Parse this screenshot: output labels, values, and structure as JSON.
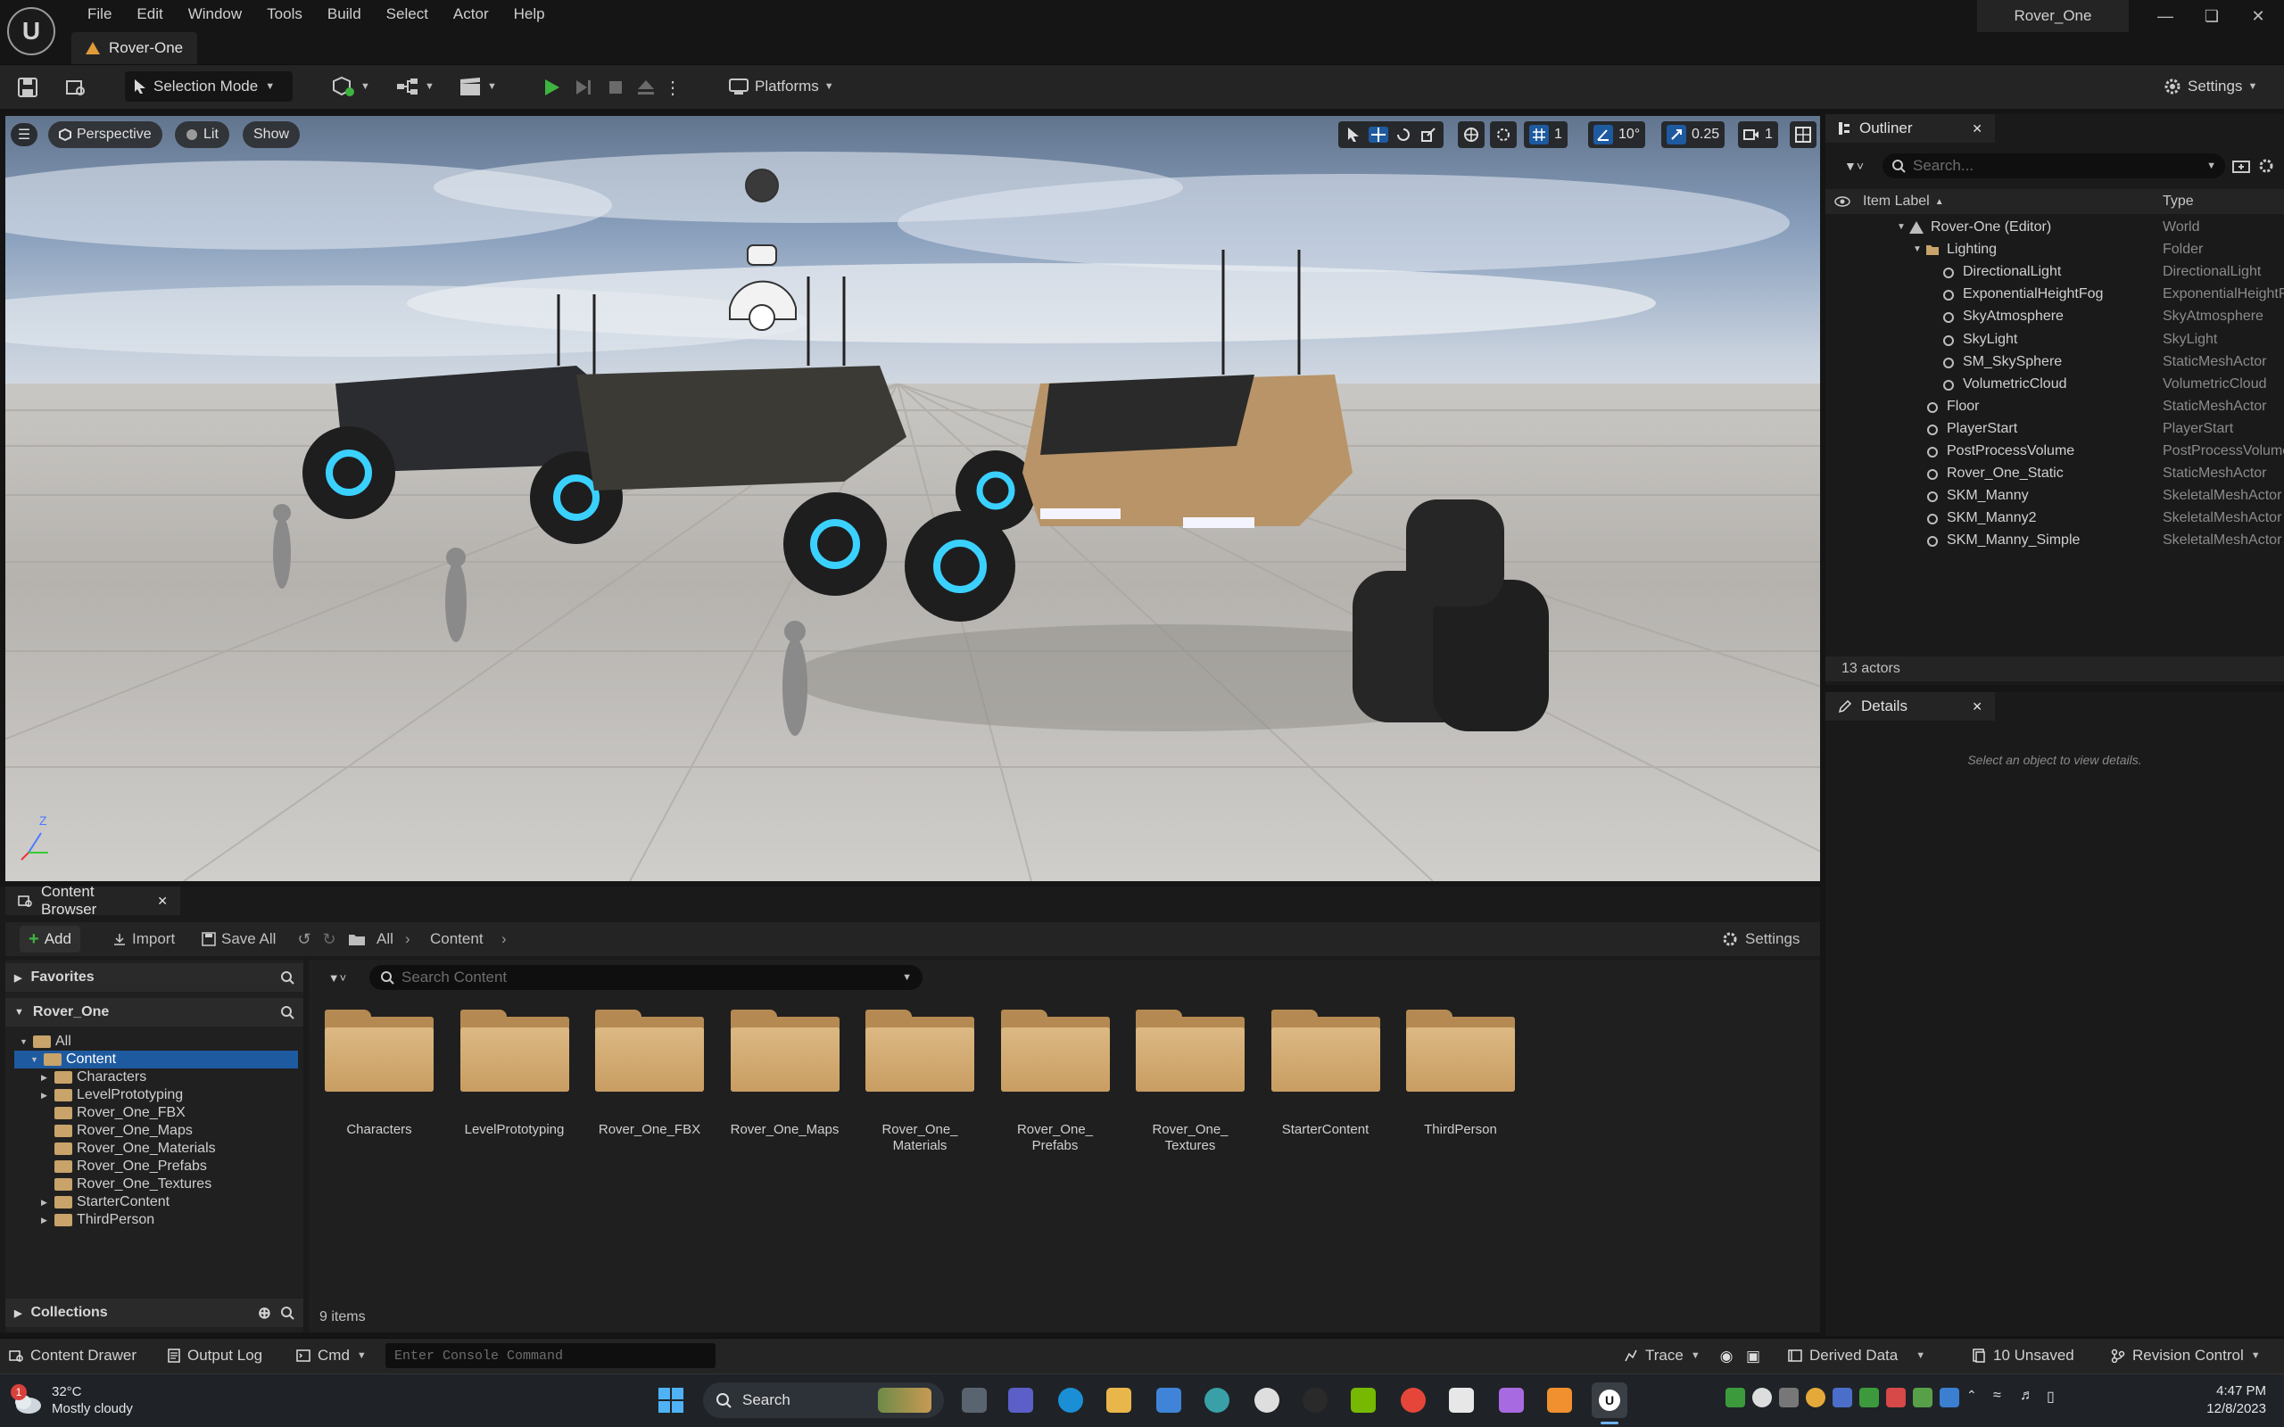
{
  "app": {
    "logo_text": "U",
    "menu": [
      "File",
      "Edit",
      "Window",
      "Tools",
      "Build",
      "Select",
      "Actor",
      "Help"
    ],
    "doc_tab": "Rover-One",
    "project_name": "Rover_One"
  },
  "toolbar": {
    "selection_mode": "Selection Mode",
    "platforms": "Platforms",
    "settings": "Settings"
  },
  "viewport": {
    "perspective": "Perspective",
    "lit": "Lit",
    "show": "Show",
    "grid_snap": "1",
    "rotation_snap": "10°",
    "scale_snap": "0.25",
    "camera_speed": "1",
    "axis_z": "Z"
  },
  "outliner": {
    "tab": "Outliner",
    "search_placeholder": "Search...",
    "col_label": "Item Label",
    "col_type": "Type",
    "rows": [
      {
        "label": "Rover-One (Editor)",
        "type": "World"
      },
      {
        "label": "Lighting",
        "type": "Folder"
      },
      {
        "label": "DirectionalLight",
        "type": "DirectionalLight"
      },
      {
        "label": "ExponentialHeightFog",
        "type": "ExponentialHeightFog"
      },
      {
        "label": "SkyAtmosphere",
        "type": "SkyAtmosphere"
      },
      {
        "label": "SkyLight",
        "type": "SkyLight"
      },
      {
        "label": "SM_SkySphere",
        "type": "StaticMeshActor"
      },
      {
        "label": "VolumetricCloud",
        "type": "VolumetricCloud"
      },
      {
        "label": "Floor",
        "type": "StaticMeshActor"
      },
      {
        "label": "PlayerStart",
        "type": "PlayerStart"
      },
      {
        "label": "PostProcessVolume",
        "type": "PostProcessVolume"
      },
      {
        "label": "Rover_One_Static",
        "type": "StaticMeshActor"
      },
      {
        "label": "SKM_Manny",
        "type": "SkeletalMeshActor"
      },
      {
        "label": "SKM_Manny2",
        "type": "SkeletalMeshActor"
      },
      {
        "label": "SKM_Manny_Simple",
        "type": "SkeletalMeshActor"
      }
    ],
    "actor_count": "13 actors"
  },
  "details": {
    "tab": "Details",
    "empty_message": "Select an object to view details."
  },
  "content_browser": {
    "tab": "Content Browser",
    "add": "Add",
    "import": "Import",
    "save_all": "Save All",
    "path": [
      "All",
      "Content"
    ],
    "settings": "Settings",
    "favorites": "Favorites",
    "project": "Rover_One",
    "collections": "Collections",
    "search_placeholder": "Search Content",
    "tree": [
      {
        "label": "All",
        "level": 0
      },
      {
        "label": "Content",
        "level": 1,
        "selected": true
      },
      {
        "label": "Characters",
        "level": 2
      },
      {
        "label": "LevelPrototyping",
        "level": 2
      },
      {
        "label": "Rover_One_FBX",
        "level": 2
      },
      {
        "label": "Rover_One_Maps",
        "level": 2
      },
      {
        "label": "Rover_One_Materials",
        "level": 2
      },
      {
        "label": "Rover_One_Prefabs",
        "level": 2
      },
      {
        "label": "Rover_One_Textures",
        "level": 2
      },
      {
        "label": "StarterContent",
        "level": 2
      },
      {
        "label": "ThirdPerson",
        "level": 2
      }
    ],
    "folders": [
      {
        "line1": "Characters",
        "line2": ""
      },
      {
        "line1": "LevelPrototyping",
        "line2": ""
      },
      {
        "line1": "Rover_One_FBX",
        "line2": ""
      },
      {
        "line1": "Rover_One_Maps",
        "line2": ""
      },
      {
        "line1": "Rover_One_",
        "line2": "Materials"
      },
      {
        "line1": "Rover_One_",
        "line2": "Prefabs"
      },
      {
        "line1": "Rover_One_",
        "line2": "Textures"
      },
      {
        "line1": "StarterContent",
        "line2": ""
      },
      {
        "line1": "ThirdPerson",
        "line2": ""
      }
    ],
    "item_count": "9 items"
  },
  "statusbar": {
    "content_drawer": "Content Drawer",
    "output_log": "Output Log",
    "cmd": "Cmd",
    "console_placeholder": "Enter Console Command",
    "trace": "Trace",
    "derived_data": "Derived Data",
    "unsaved": "10 Unsaved",
    "revision_control": "Revision Control"
  },
  "taskbar": {
    "weather_temp": "32°C",
    "weather_desc": "Mostly cloudy",
    "weather_badge": "1",
    "search": "Search",
    "time": "4:47 PM",
    "date": "12/8/2023"
  },
  "colors": {
    "accent_green": "#3fb33f",
    "selection_blue": "#1e5aa0",
    "folder": "#c89d62"
  }
}
